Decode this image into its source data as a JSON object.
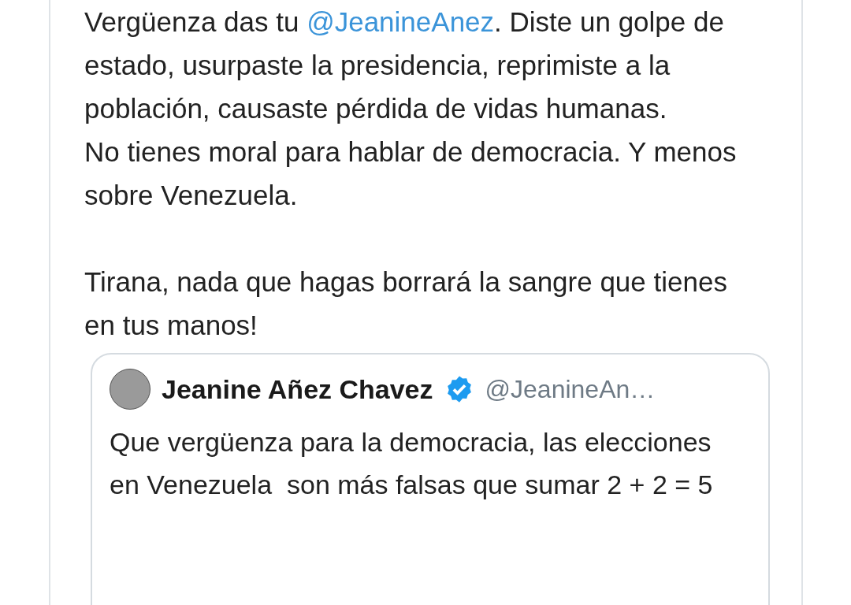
{
  "tweet": {
    "paragraphs": [
      [
        {
          "kind": "text",
          "text": "Vergüenza das tu "
        },
        {
          "kind": "mention",
          "text": "@JeanineAnez"
        },
        {
          "kind": "text",
          "text": ". Diste un golpe de estado, usurpaste la presidencia, reprimiste a la población, causaste pérdida de vidas humanas.\nNo tienes moral para hablar de democracia. Y menos sobre Venezuela."
        }
      ],
      [
        {
          "kind": "text",
          "text": "Tirana, nada que hagas borrará la sangre que tienes en tus manos!"
        }
      ]
    ]
  },
  "quoted_tweet": {
    "name": "Jeanine Añez Chavez",
    "verified": true,
    "handle": "@JeanineAn…",
    "text": "Que vergüenza para la democracia, las elecciones en Venezuela  son más falsas que sumar 2 + 2 = 5"
  }
}
